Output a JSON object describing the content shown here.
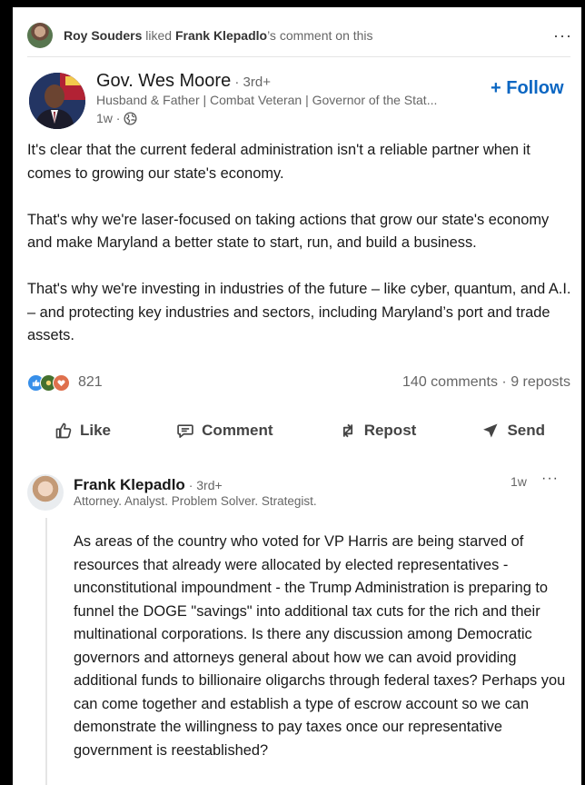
{
  "activity": {
    "actor": "Roy Souders",
    "verb": " liked ",
    "target": "Frank Klepadlo",
    "suffix": "’s comment on this",
    "more_label": "···"
  },
  "author": {
    "name": "Gov. Wes Moore",
    "degree": " · 3rd+",
    "headline": "Husband & Father | Combat Veteran | Governor of the Stat...",
    "time": "1w ·"
  },
  "follow_label": "+ Follow",
  "post": {
    "paragraphs": [
      "It's clear that the current federal administration isn't a reliable partner when it comes to growing our state's economy.",
      "That's why we're laser-focused on taking actions that grow our state's economy and make Maryland a better state to start, run, and build a business.",
      "That's why we're investing in industries of the future – like cyber, quantum, and A.I. – and protecting key industries and sectors, including Maryland’s port and trade assets."
    ]
  },
  "social": {
    "reaction_count": "821",
    "comments_reposts": "140 comments · 9 reposts"
  },
  "actions": {
    "like": "Like",
    "comment": "Comment",
    "repost": "Repost",
    "send": "Send"
  },
  "comment": {
    "name": "Frank Klepadlo",
    "degree": " · 3rd+",
    "headline": "Attorney. Analyst. Problem Solver. Strategist.",
    "time": "1w",
    "more_label": "···",
    "text": "As areas of the country who voted for VP Harris are being starved of resources that already were allocated by elected representatives - unconstitutional impoundment - the Trump Administration is preparing to funnel the DOGE \"savings\" into additional tax cuts for the rich and their multinational corporations. Is there any discussion among Democratic governors and attorneys general about how we can avoid providing additional funds to billionaire oligarchs through federal taxes? Perhaps you can come together and establish a type of escrow account so we can demonstrate the willingness to pay taxes once our representative government is reestablished?"
  },
  "colors": {
    "link_blue": "#0a66c2",
    "muted_text": "#666666",
    "like_blue": "#378fe9",
    "celebrate_green": "#44712e",
    "love_red": "#df704d"
  }
}
